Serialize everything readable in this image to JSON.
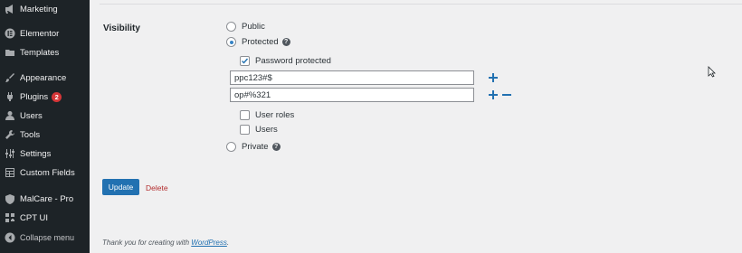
{
  "sidebar": {
    "items": [
      {
        "label": "Marketing",
        "icon": "megaphone-icon"
      },
      {
        "label": "Elementor",
        "icon": "elementor-icon"
      },
      {
        "label": "Templates",
        "icon": "folder-icon"
      },
      {
        "label": "Appearance",
        "icon": "brush-icon"
      },
      {
        "label": "Plugins",
        "icon": "plug-icon",
        "badge": "2"
      },
      {
        "label": "Users",
        "icon": "user-icon"
      },
      {
        "label": "Tools",
        "icon": "wrench-icon"
      },
      {
        "label": "Settings",
        "icon": "settings-icon"
      },
      {
        "label": "Custom Fields",
        "icon": "grid-icon"
      },
      {
        "label": "MalCare - Pro",
        "icon": "shield-icon"
      },
      {
        "label": "CPT UI",
        "icon": "cpt-icon"
      },
      {
        "label": "Collapse menu",
        "icon": "collapse-icon"
      }
    ]
  },
  "visibility": {
    "label": "Visibility",
    "public_label": "Public",
    "protected_label": "Protected",
    "private_label": "Private",
    "help_glyph": "?",
    "selected": "protected",
    "password_protected_label": "Password protected",
    "password_protected_checked": true,
    "passwords": [
      "ppc123#$",
      "op#%321"
    ],
    "user_roles_label": "User roles",
    "users_label": "Users"
  },
  "actions": {
    "update_label": "Update",
    "delete_label": "Delete"
  },
  "footer": {
    "text": "Thank you for creating with ",
    "link": "WordPress",
    "end": "."
  },
  "colors": {
    "sidebar_bg": "#1d2327",
    "accent": "#2271b1",
    "danger": "#b32d2e",
    "badge": "#d63638"
  }
}
